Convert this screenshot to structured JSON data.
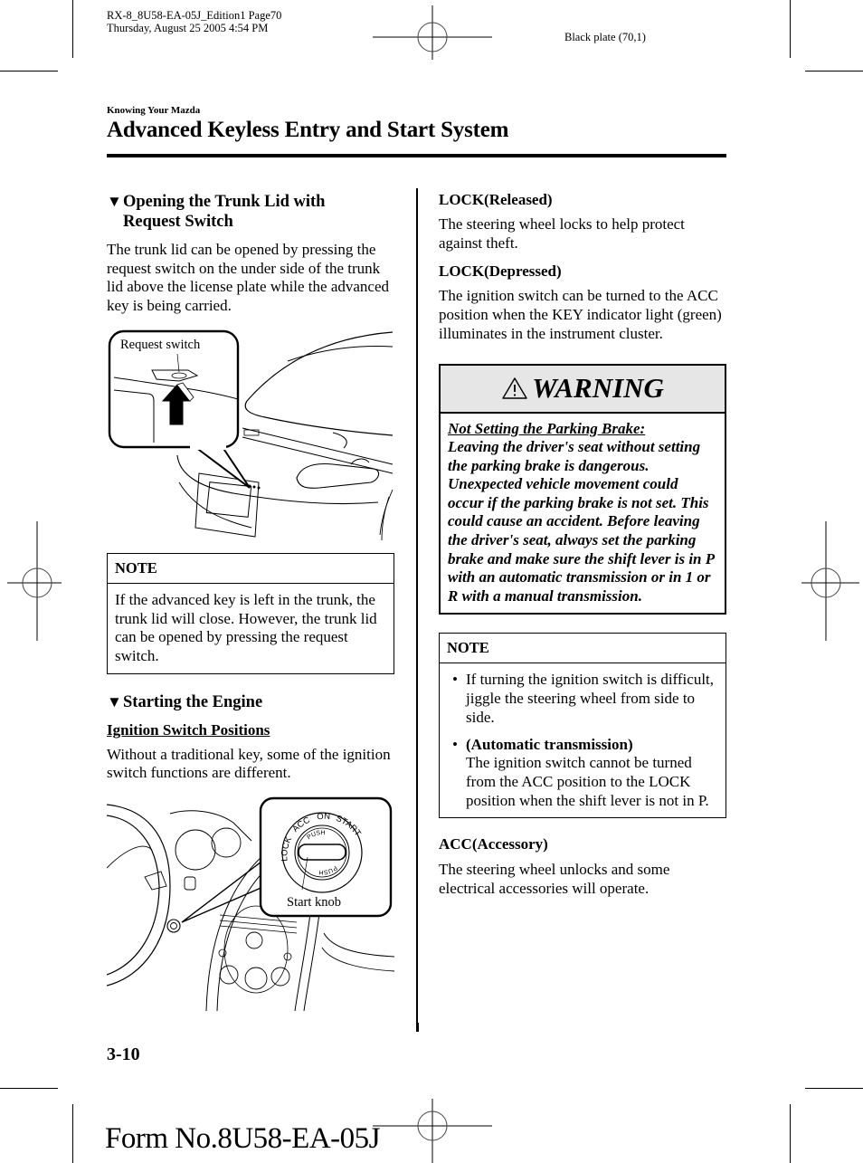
{
  "print_header": {
    "job_line": "RX-8_8U58-EA-05J_Edition1 Page70",
    "date_line": "Thursday, August 25 2005 4:54 PM",
    "plate": "Black plate (70,1)"
  },
  "section_label": "Knowing Your Mazda",
  "page_title": "Advanced Keyless Entry and Start System",
  "left_column": {
    "trunk": {
      "marker": "▼",
      "heading_line1": "Opening the Trunk Lid with",
      "heading_line2": "Request Switch",
      "body": "The trunk lid can be opened by pressing the request switch on the under side of the trunk lid above the license plate while the advanced key is being carried.",
      "figure_callout": "Request switch"
    },
    "note": {
      "heading": "NOTE",
      "body": "If the advanced key is left in the trunk, the trunk lid will close. However, the trunk lid can be opened by pressing the request switch."
    },
    "engine": {
      "marker": "▼",
      "heading": "Starting the Engine",
      "subheading": "Ignition Switch Positions",
      "body": "Without a traditional key, some of the ignition switch functions are different.",
      "figure_callout": "Start knob",
      "switch_positions": [
        "LOCK",
        "ACC",
        "ON",
        "START"
      ],
      "push_label": "PUSH"
    }
  },
  "right_column": {
    "lock_released": {
      "heading": "LOCK(Released)",
      "body": "The steering wheel locks to help protect against theft."
    },
    "lock_depressed": {
      "heading": "LOCK(Depressed)",
      "body": "The ignition switch can be turned to the ACC position when the KEY indicator light (green) illuminates in the instrument cluster."
    },
    "warning": {
      "icon": "warning-triangle-icon",
      "title": "WARNING",
      "lead": "Not Setting the Parking Brake:",
      "body": "Leaving the driver's seat without setting the parking brake is dangerous. Unexpected vehicle movement could occur if the parking brake is not set. This could cause an accident. Before leaving the driver's seat, always set the parking brake and make sure the shift lever is in P with an automatic transmission or in 1 or R with a manual transmission."
    },
    "note": {
      "heading": "NOTE",
      "bullet": "•",
      "items": [
        {
          "lead": "",
          "text": "If turning the ignition switch is difficult, jiggle the steering wheel from side to side."
        },
        {
          "lead": "(Automatic transmission)",
          "text": "The ignition switch cannot be turned from the ACC position to the LOCK position when the shift lever is not in P."
        }
      ]
    },
    "acc": {
      "heading": "ACC(Accessory)",
      "body": "The steering wheel unlocks and some electrical accessories will operate."
    }
  },
  "page_number": "3-10",
  "form_number": "Form No.8U58-EA-05J"
}
